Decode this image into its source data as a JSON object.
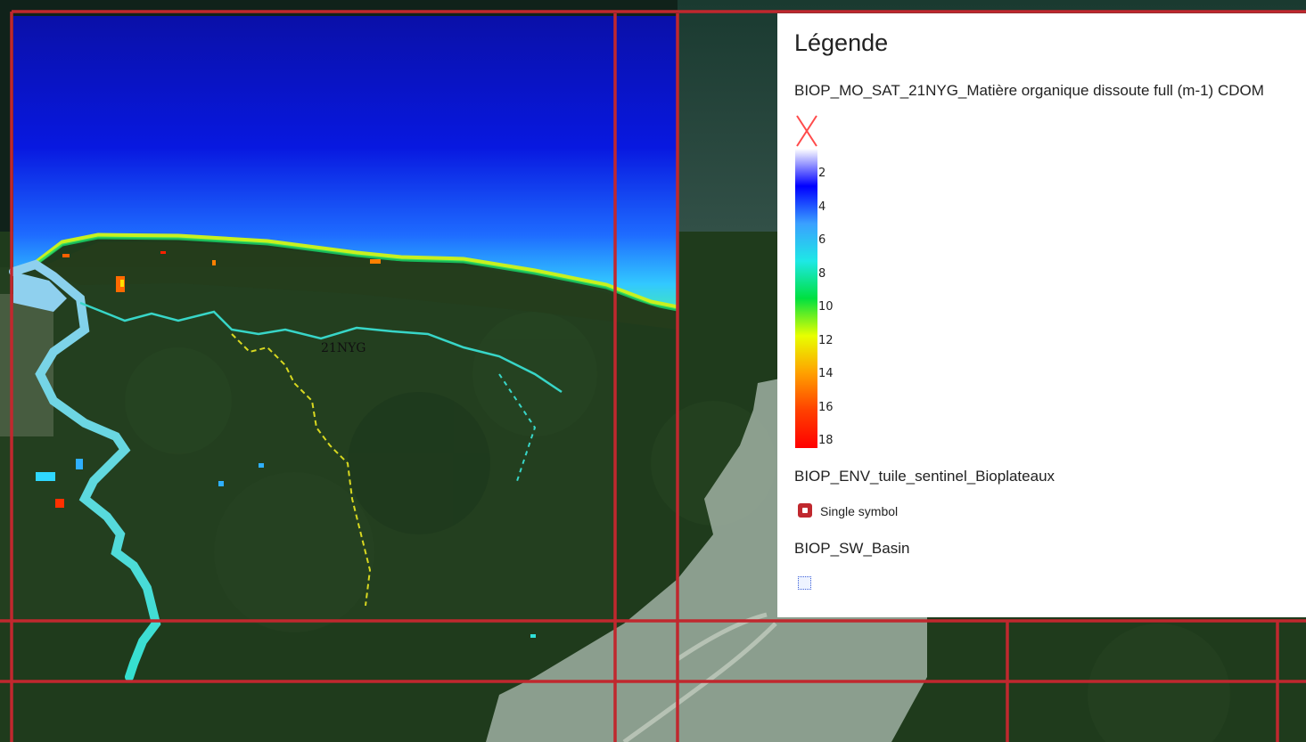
{
  "map": {
    "tile_label": "21NYG",
    "basemap": "satellite imagery",
    "colors": {
      "grid": "#c0282e",
      "forest": "#1f3b1c",
      "ocean": "#0a10d8",
      "basin": "#9fb0a2"
    }
  },
  "legend": {
    "title": "Légende",
    "layers": [
      {
        "name": "BIOP_MO_SAT_21NYG_Matière organique dissoute full (m-1) CDOM",
        "nodata_icon": "red-cross-icon",
        "ramp_ticks": [
          "2",
          "4",
          "6",
          "8",
          "10",
          "12",
          "14",
          "16",
          "18"
        ],
        "ramp_colors": [
          "#ffffff",
          "#0000ff",
          "#3aa0ff",
          "#1ee8e6",
          "#00e040",
          "#e8ff00",
          "#ffa000",
          "#ff4000",
          "#ff0000"
        ]
      },
      {
        "name": "BIOP_ENV_tuile_sentinel_Bioplateaux",
        "symbol_label": "Single symbol",
        "symbol_icon": "red-square-symbol-icon"
      },
      {
        "name": "BIOP_SW_Basin",
        "symbol_icon": "dotted-blue-square-icon"
      }
    ]
  }
}
